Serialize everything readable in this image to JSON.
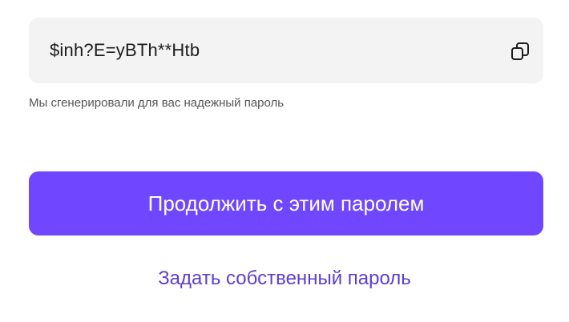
{
  "password_field": {
    "value": "$inh?E=yBTh**Htb",
    "copy_icon": "copy-icon"
  },
  "hint": "Мы сгенерировали для вас надежный пароль",
  "actions": {
    "continue_label": "Продолжить с этим паролем",
    "custom_label": "Задать собственный пароль"
  },
  "colors": {
    "accent": "#7047ff",
    "link": "#5b3fd1",
    "field_bg": "#f3f3f3"
  }
}
